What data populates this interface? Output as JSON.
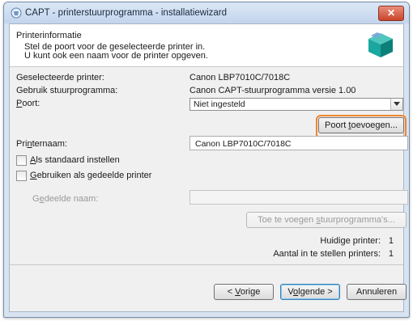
{
  "window": {
    "title": "CAPT - printerstuurprogramma - installatiewizard",
    "close_label": "✕"
  },
  "header": {
    "title": "Printerinformatie",
    "subtitle_line1": "Stel de poort voor de geselecteerde printer in.",
    "subtitle_line2": "U kunt ook een naam voor de printer opgeven."
  },
  "info": {
    "selected_printer_label": "Geselecteerde printer:",
    "selected_printer_value": "Canon LBP7010C/7018C",
    "driver_label": "Gebruik stuurprogramma:",
    "driver_value": "Canon CAPT-stuurprogramma versie 1.00"
  },
  "port": {
    "label_accel": "P",
    "label_rest": "oort:",
    "selected": "Niet ingesteld",
    "add_port_pre": "Poort ",
    "add_port_accel": "t",
    "add_port_post": "oevoegen..."
  },
  "printer_name": {
    "label_pre": "Pri",
    "label_accel": "n",
    "label_post": "ternaam:",
    "value": "Canon LBP7010C/7018C"
  },
  "options": {
    "default_pre": "",
    "default_accel": "A",
    "default_post": "ls standaard instellen",
    "shared_accel": "G",
    "shared_post": "ebruiken als gedeelde printer",
    "shared_name_pre": "G",
    "shared_name_accel": "e",
    "shared_name_post": "deelde naam:",
    "add_drivers_pre": "Toe te voegen ",
    "add_drivers_accel": "s",
    "add_drivers_post": "tuurprogramma's..."
  },
  "counts": {
    "current_label": "Huidige printer:",
    "current_value": "1",
    "total_label": "Aantal in te stellen printers:",
    "total_value": "1"
  },
  "footer": {
    "back_pre": "< ",
    "back_accel": "V",
    "back_post": "orige",
    "next_pre": "V",
    "next_accel": "o",
    "next_post": "lgende >",
    "cancel": "Annuleren"
  },
  "colors": {
    "highlight": "#f0842c",
    "title_bar": "#c3d5ec",
    "icon_accent": "#1aa7a0"
  }
}
